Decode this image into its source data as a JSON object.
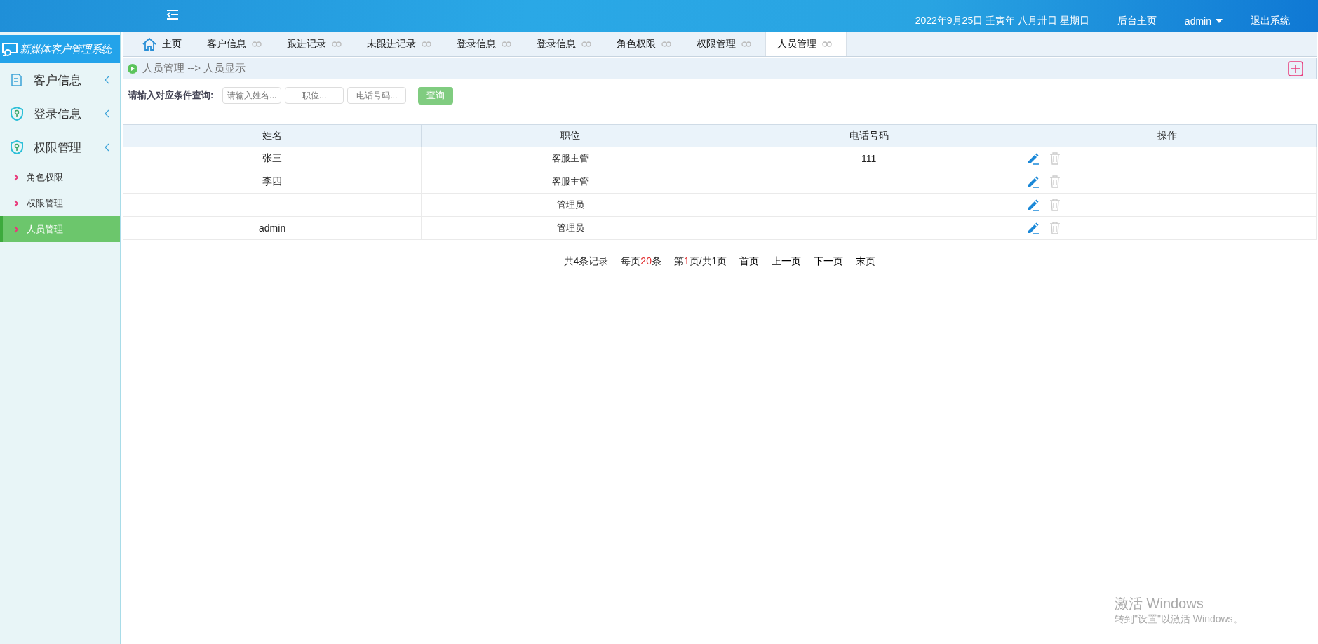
{
  "header": {
    "date": "2022年9月25日 壬寅年 八月卅日 星期日",
    "links": [
      {
        "label": "后台主页",
        "kind": "link"
      },
      {
        "label": "admin",
        "kind": "dropdown"
      },
      {
        "label": "退出系统",
        "kind": "link"
      }
    ]
  },
  "sidebar": {
    "title": "新媒体客户管理系统",
    "items": [
      {
        "label": "客户信息",
        "kind": "document"
      },
      {
        "label": "登录信息",
        "kind": "shield"
      },
      {
        "label": "权限管理",
        "kind": "shield",
        "children": [
          {
            "label": "角色权限",
            "selected": false
          },
          {
            "label": "权限管理",
            "selected": false
          },
          {
            "label": "人员管理",
            "selected": true
          }
        ]
      }
    ]
  },
  "tabs": [
    {
      "label": "主页",
      "kind": "home",
      "selected": false
    },
    {
      "label": "客户信息",
      "kind": "closable",
      "selected": false
    },
    {
      "label": "跟进记录",
      "kind": "closable",
      "selected": false
    },
    {
      "label": "未跟进记录",
      "kind": "closable",
      "selected": false
    },
    {
      "label": "登录信息",
      "kind": "closable",
      "selected": false
    },
    {
      "label": "登录信息",
      "kind": "closable",
      "selected": false
    },
    {
      "label": "角色权限",
      "kind": "closable",
      "selected": false
    },
    {
      "label": "权限管理",
      "kind": "closable",
      "selected": false
    },
    {
      "label": "人员管理",
      "kind": "closable",
      "selected": true
    }
  ],
  "breadcrumb": "人员管理 --> 人员显示",
  "search": {
    "label": "请输入对应条件查询:",
    "fields": [
      {
        "placeholder": "请输入姓名..."
      },
      {
        "placeholder": "职位..."
      },
      {
        "placeholder": "电话号码..."
      }
    ],
    "button": "查询"
  },
  "table": {
    "columns": [
      "姓名",
      "职位",
      "电话号码",
      "操作"
    ],
    "rows": [
      {
        "name": "张三",
        "position": "客服主管",
        "phone": "111"
      },
      {
        "name": "李四",
        "position": "客服主管",
        "phone": ""
      },
      {
        "name": "",
        "position": "管理员",
        "phone": ""
      },
      {
        "name": "admin",
        "position": "管理员",
        "phone": ""
      }
    ]
  },
  "pagination": [
    {
      "parts": [
        {
          "text": "共4条记录",
          "highlight": false
        }
      ],
      "kind": "info"
    },
    {
      "parts": [
        {
          "text": "每页",
          "highlight": false
        },
        {
          "text": "20",
          "highlight": true
        },
        {
          "text": "条",
          "highlight": false
        }
      ],
      "kind": "info"
    },
    {
      "parts": [
        {
          "text": "第",
          "highlight": false
        },
        {
          "text": "1",
          "highlight": true
        },
        {
          "text": "页/共1页",
          "highlight": false
        }
      ],
      "kind": "info"
    },
    {
      "parts": [
        {
          "text": "首页",
          "highlight": false
        }
      ],
      "kind": "link"
    },
    {
      "parts": [
        {
          "text": "上一页",
          "highlight": false
        }
      ],
      "kind": "link"
    },
    {
      "parts": [
        {
          "text": "下一页",
          "highlight": false
        }
      ],
      "kind": "link"
    },
    {
      "parts": [
        {
          "text": "末页",
          "highlight": false
        }
      ],
      "kind": "link"
    }
  ],
  "activation": {
    "title": "激活 Windows",
    "text": "转到\"设置\"以激活 Windows。"
  }
}
